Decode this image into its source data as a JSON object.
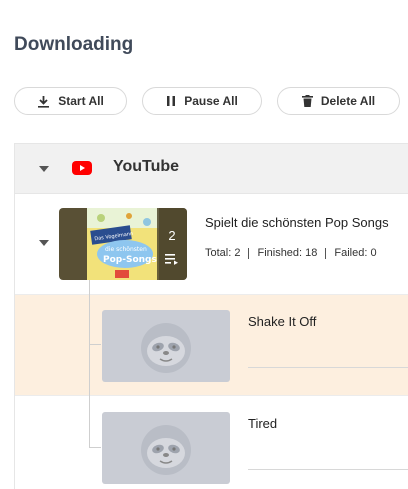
{
  "page": {
    "title": "Downloading"
  },
  "toolbar": {
    "start_all": "Start All",
    "pause_all": "Pause All",
    "delete_all": "Delete All"
  },
  "group": {
    "title": "YouTube",
    "icon": "youtube-icon",
    "icon_color": "#ff0000"
  },
  "playlist": {
    "title": "Spielt die schönsten Pop Songs",
    "count": "2",
    "stats": {
      "total": "Total: 2",
      "finished": "Finished: 18",
      "failed": "Failed: 0"
    },
    "thumbnail_text": {
      "line1": "Das Vogelmann",
      "line2": "die schönsten",
      "line3": "Pop-Songs"
    }
  },
  "items": [
    {
      "title": "Shake It Off",
      "selected": true
    },
    {
      "title": "Tired",
      "selected": false
    }
  ],
  "colors": {
    "title": "#404a5a",
    "selected_row": "#fdefdf",
    "placeholder_thumb": "#c9ccd4",
    "header_bg": "#f1f1f1"
  }
}
